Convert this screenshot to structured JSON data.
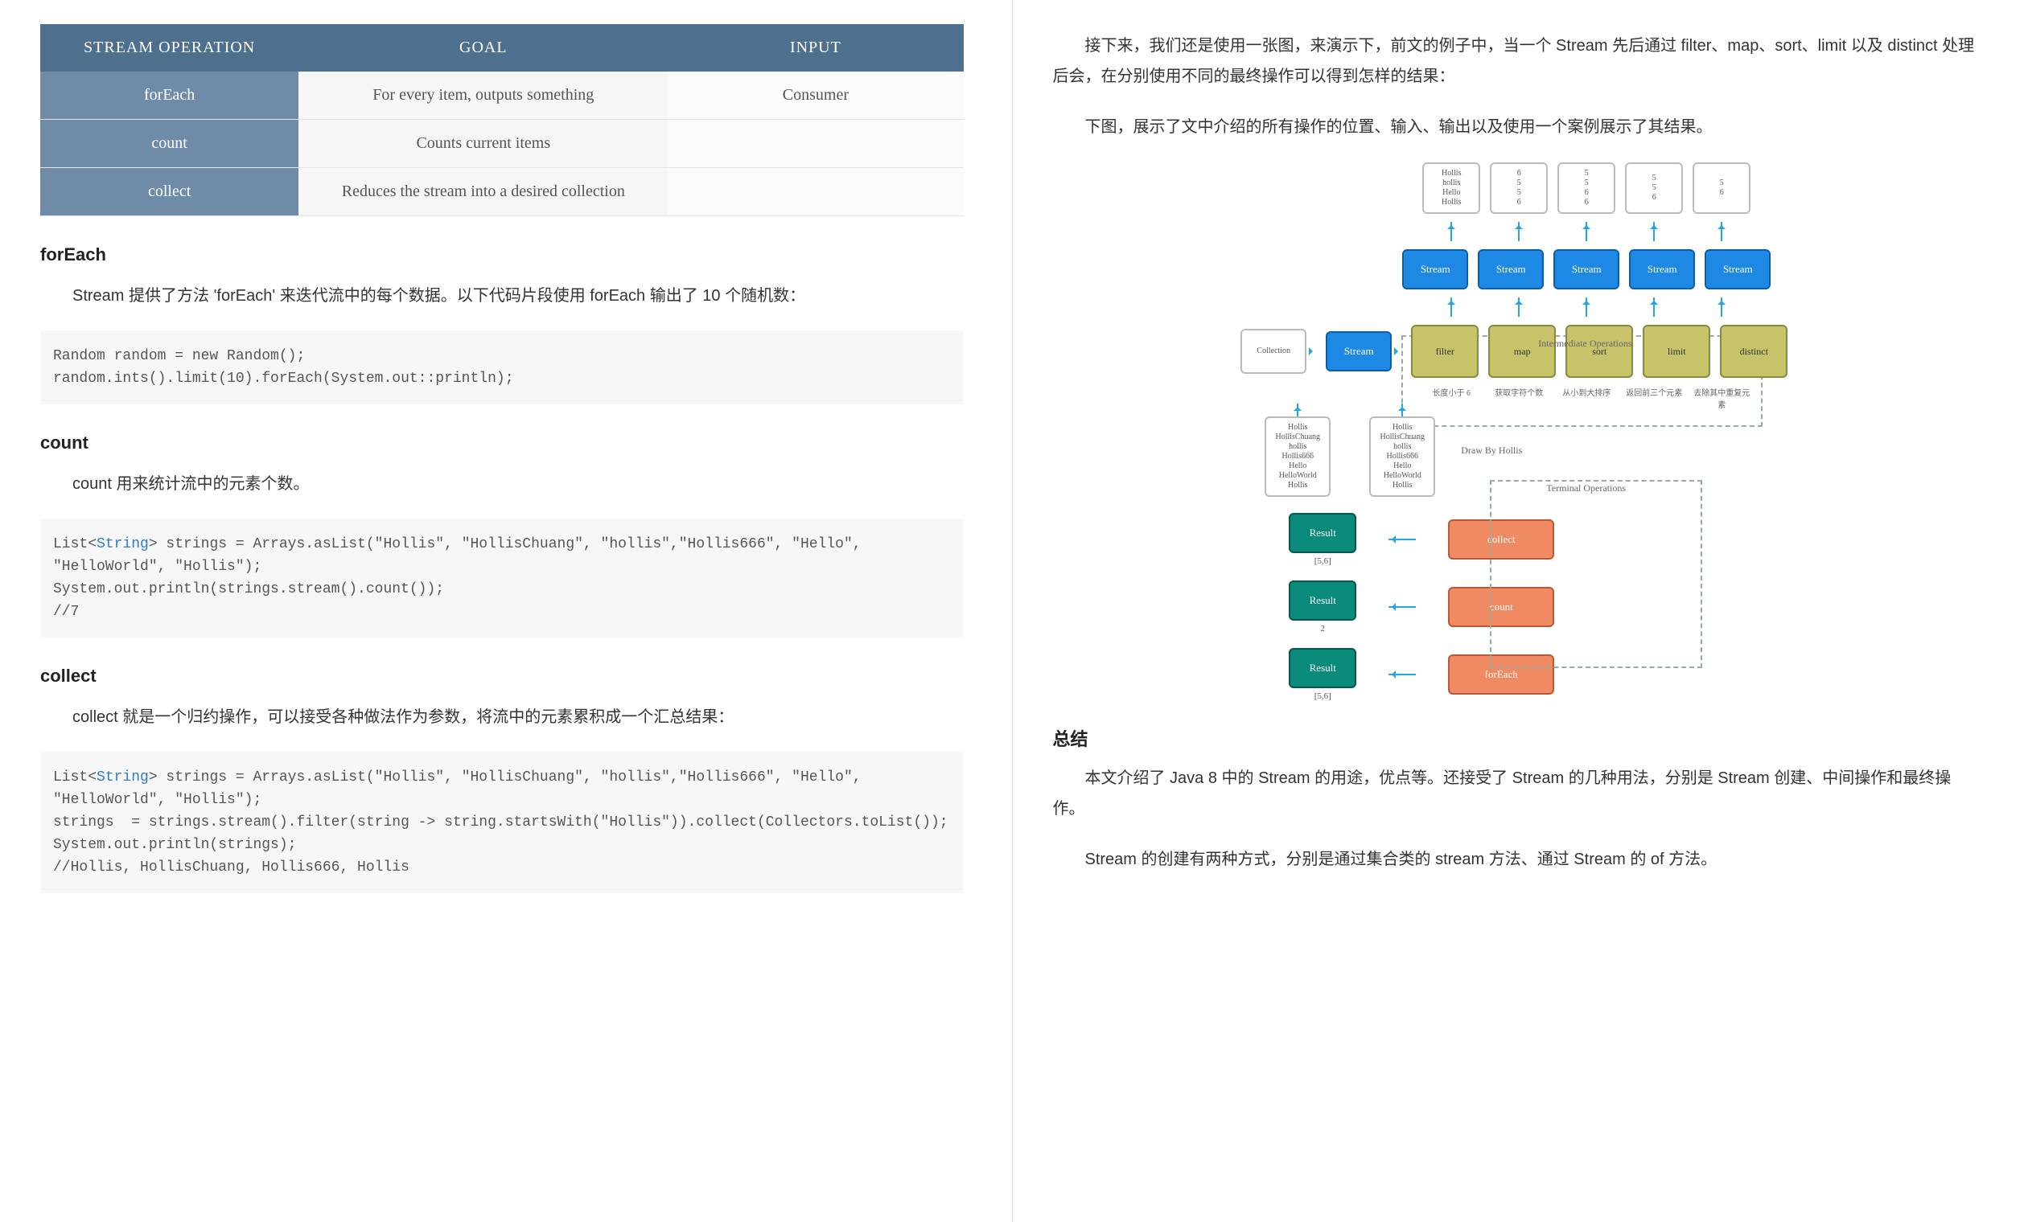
{
  "left": {
    "table": {
      "headers": [
        "STREAM OPERATION",
        "GOAL",
        "INPUT"
      ],
      "rows": [
        {
          "op": "forEach",
          "goal": "For every item, outputs something",
          "input": "Consumer"
        },
        {
          "op": "count",
          "goal": "Counts current items",
          "input": ""
        },
        {
          "op": "collect",
          "goal": "Reduces the stream into a desired collection",
          "input": ""
        }
      ]
    },
    "sections": {
      "forEach": {
        "title": "forEach",
        "para": "Stream 提供了方法 'forEach' 来迭代流中的每个数据。以下代码片段使用 forEach 输出了 10 个随机数：",
        "code": "Random random = new Random();\nrandom.ints().limit(10).forEach(System.out::println);"
      },
      "count": {
        "title": "count",
        "para": "count 用来统计流中的元素个数。",
        "code": "List<String> strings = Arrays.asList(\"Hollis\", \"HollisChuang\", \"hollis\",\"Hollis666\", \"Hello\", \"HelloWorld\", \"Hollis\");\nSystem.out.println(strings.stream().count());\n//7"
      },
      "collect": {
        "title": "collect",
        "para": "collect 就是一个归约操作，可以接受各种做法作为参数，将流中的元素累积成一个汇总结果：",
        "code": "List<String> strings = Arrays.asList(\"Hollis\", \"HollisChuang\", \"hollis\",\"Hollis666\", \"Hello\", \"HelloWorld\", \"Hollis\");\nstrings  = strings.stream().filter(string -> string.startsWith(\"Hollis\")).collect(Collectors.toList());\nSystem.out.println(strings);\n//Hollis, HollisChuang, Hollis666, Hollis"
      }
    }
  },
  "right": {
    "para1": "接下来，我们还是使用一张图，来演示下，前文的例子中，当一个 Stream 先后通过 filter、map、sort、limit 以及 distinct 处理后会，在分别使用不同的最终操作可以得到怎样的结果：",
    "para2": "下图，展示了文中介绍的所有操作的位置、输入、输出以及使用一个案例展示了其结果。",
    "diagram": {
      "topBoxes": [
        [
          "Hollis",
          "hollis",
          "Hello",
          "Hollis"
        ],
        [
          "6",
          "5",
          "5",
          "6"
        ],
        [
          "5",
          "5",
          "6",
          "6"
        ],
        [
          "5",
          "5",
          "6"
        ],
        [
          "5",
          "6"
        ]
      ],
      "streamRow": [
        "Stream",
        "Stream",
        "Stream",
        "Stream",
        "Stream"
      ],
      "intermediateLabel": "Intermediate Operations",
      "collection": "Collection",
      "stream0": "Stream",
      "filters": [
        "filter",
        "map",
        "sort",
        "limit",
        "distinct"
      ],
      "filterCaptions": [
        "长度小于 6",
        "获取字符个数",
        "从小到大排序",
        "返回前三个元素",
        "去除其中重复元素"
      ],
      "collList": [
        "Hollis",
        "HollisChuang",
        "hollis",
        "Hollis666",
        "Hello",
        "HelloWorld",
        "Hollis"
      ],
      "streamList": [
        "Hollis",
        "HollisChuang",
        "hollis",
        "Hollis666",
        "Hello",
        "HelloWorld",
        "Hollis"
      ],
      "drawBy": "Draw By Hollis",
      "terminalLabel": "Terminal Operations",
      "terminals": [
        {
          "result": "Result",
          "value": "[5,6]",
          "op": "collect"
        },
        {
          "result": "Result",
          "value": "2",
          "op": "count"
        },
        {
          "result": "Result",
          "value": "[5,6]",
          "op": "forEach"
        }
      ]
    },
    "summary": {
      "title": "总结",
      "p1": "本文介绍了 Java 8 中的 Stream 的用途，优点等。还接受了 Stream 的几种用法，分别是 Stream 创建、中间操作和最终操作。",
      "p2": "Stream 的创建有两种方式，分别是通过集合类的 stream 方法、通过 Stream 的 of 方法。"
    }
  }
}
